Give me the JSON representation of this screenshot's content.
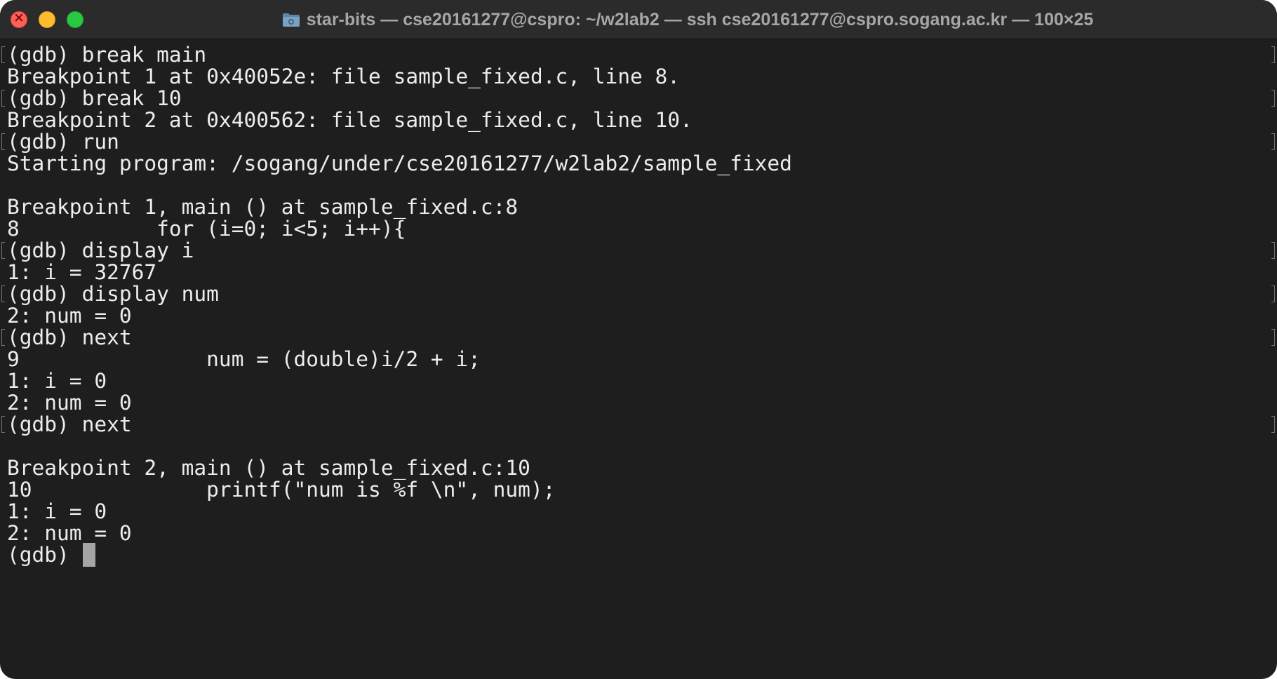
{
  "window": {
    "title": "star-bits — cse20161277@cspro: ~/w2lab2 — ssh cse20161277@cspro.sogang.ac.kr — 100×25"
  },
  "colors": {
    "background": "#1e1e1e",
    "titlebar": "#2b2b2b",
    "text": "#ececec",
    "cursor": "#a5a5a5",
    "close": "#ff5f57",
    "minimize": "#febc2e",
    "maximize": "#28c840"
  },
  "terminal": {
    "lines": [
      {
        "text": "(gdb) break main",
        "marked": true
      },
      {
        "text": "Breakpoint 1 at 0x40052e: file sample_fixed.c, line 8.",
        "marked": false
      },
      {
        "text": "(gdb) break 10",
        "marked": true
      },
      {
        "text": "Breakpoint 2 at 0x400562: file sample_fixed.c, line 10.",
        "marked": false
      },
      {
        "text": "(gdb) run",
        "marked": true
      },
      {
        "text": "Starting program: /sogang/under/cse20161277/w2lab2/sample_fixed",
        "marked": false
      },
      {
        "text": "",
        "marked": false
      },
      {
        "text": "Breakpoint 1, main () at sample_fixed.c:8",
        "marked": false
      },
      {
        "text": "8           for (i=0; i<5; i++){",
        "marked": false
      },
      {
        "text": "(gdb) display i",
        "marked": true
      },
      {
        "text": "1: i = 32767",
        "marked": false
      },
      {
        "text": "(gdb) display num",
        "marked": true
      },
      {
        "text": "2: num = 0",
        "marked": false
      },
      {
        "text": "(gdb) next",
        "marked": true
      },
      {
        "text": "9               num = (double)i/2 + i;",
        "marked": false
      },
      {
        "text": "1: i = 0",
        "marked": false
      },
      {
        "text": "2: num = 0",
        "marked": false
      },
      {
        "text": "(gdb) next",
        "marked": true
      },
      {
        "text": "",
        "marked": false
      },
      {
        "text": "Breakpoint 2, main () at sample_fixed.c:10",
        "marked": false
      },
      {
        "text": "10              printf(\"num is %f \\n\", num);",
        "marked": false
      },
      {
        "text": "1: i = 0",
        "marked": false
      },
      {
        "text": "2: num = 0",
        "marked": false
      },
      {
        "text": "(gdb) ",
        "marked": false,
        "cursor": true
      }
    ]
  }
}
